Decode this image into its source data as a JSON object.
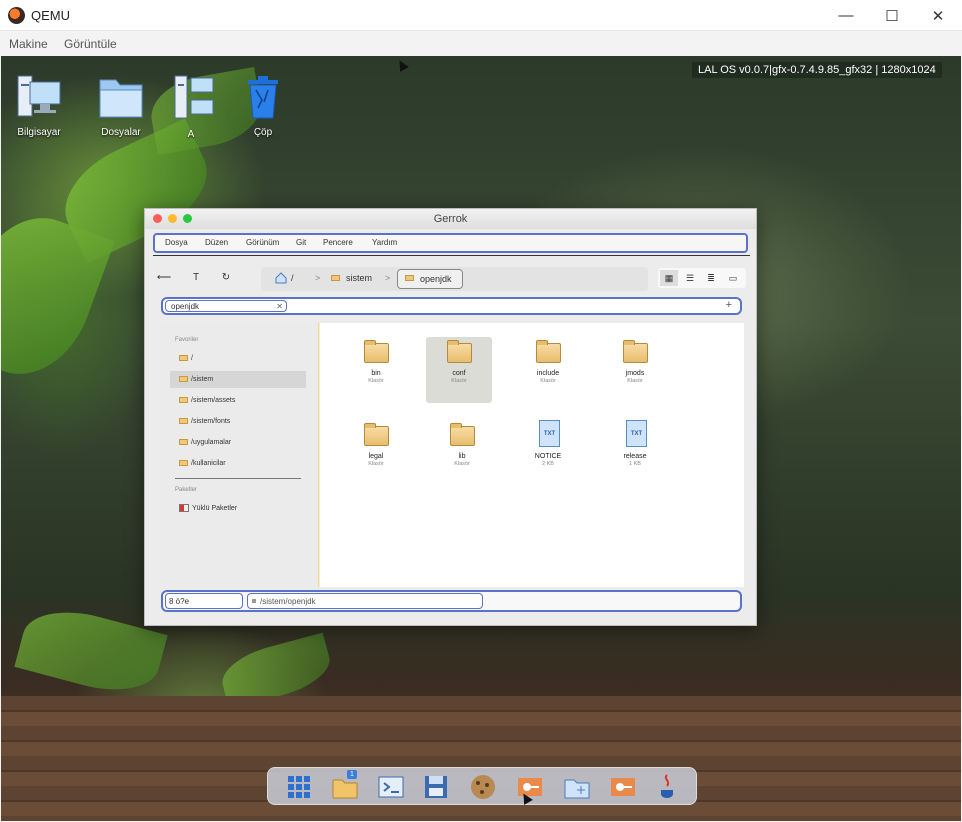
{
  "host": {
    "title": "QEMU",
    "menu": [
      "Makine",
      "Görüntüle"
    ],
    "controls": {
      "minimize": "—",
      "maximize": "☐",
      "close": "✕"
    }
  },
  "guest": {
    "os_info": "LAL OS v0.0.7|gfx-0.7.4.9.85_gfx32 | 1280x1024",
    "desktop_icons": [
      {
        "label": "Bilgisayar",
        "icon": "computer-icon"
      },
      {
        "label": "Dosyalar",
        "icon": "folder-icon"
      },
      {
        "label": "A",
        "icon": "network-icon"
      },
      {
        "label": "Çöp",
        "icon": "trash-icon"
      }
    ]
  },
  "window": {
    "title": "Gerrok",
    "menu": [
      "Dosya",
      "Düzen",
      "Görünüm",
      "Git",
      "Pencere",
      "Yardım"
    ],
    "nav": {
      "back": "⟵",
      "up": "T",
      "refresh": "↻"
    },
    "breadcrumb": [
      "/",
      "sistem",
      "openjdk"
    ],
    "breadcrumb_sep": ">",
    "view_buttons": [
      "grid-view-icon",
      "list-view-icon",
      "detail-view-icon",
      "preview-view-icon"
    ],
    "search": {
      "value": "openjdk",
      "clear": "✕",
      "add": "+"
    },
    "sidebar": {
      "favorites_heading": "Favoriler",
      "favorites": [
        "/",
        "/sistem",
        "/sistem/assets",
        "/sistem/fonts",
        "/uygulamalar",
        "/kullanicilar"
      ],
      "selected": "/sistem",
      "packages_heading": "Paketler",
      "packages": [
        "Yüklü Paketler"
      ]
    },
    "files": [
      {
        "name": "bin",
        "kind": "Klasör",
        "type": "folder"
      },
      {
        "name": "conf",
        "kind": "Klasör",
        "type": "folder",
        "selected": true
      },
      {
        "name": "include",
        "kind": "Klasör",
        "type": "folder"
      },
      {
        "name": "jmods",
        "kind": "Klasör",
        "type": "folder"
      },
      {
        "name": "legal",
        "kind": "Klasör",
        "type": "folder"
      },
      {
        "name": "lib",
        "kind": "Klasör",
        "type": "folder"
      },
      {
        "name": "NOTICE",
        "kind": "2 KB",
        "type": "txt"
      },
      {
        "name": "release",
        "kind": "1 KB",
        "type": "txt"
      }
    ],
    "file_badge": "TXT",
    "status": {
      "count": "8 ö?e",
      "path": "/sistem/openjdk"
    }
  },
  "dock": {
    "items": [
      "apps-grid-icon",
      "file-manager-icon",
      "terminal-icon",
      "editor-icon",
      "cookie-app-icon",
      "network-tool-icon",
      "files-icon",
      "network-tool-icon-2",
      "java-icon"
    ],
    "badge": "1"
  }
}
